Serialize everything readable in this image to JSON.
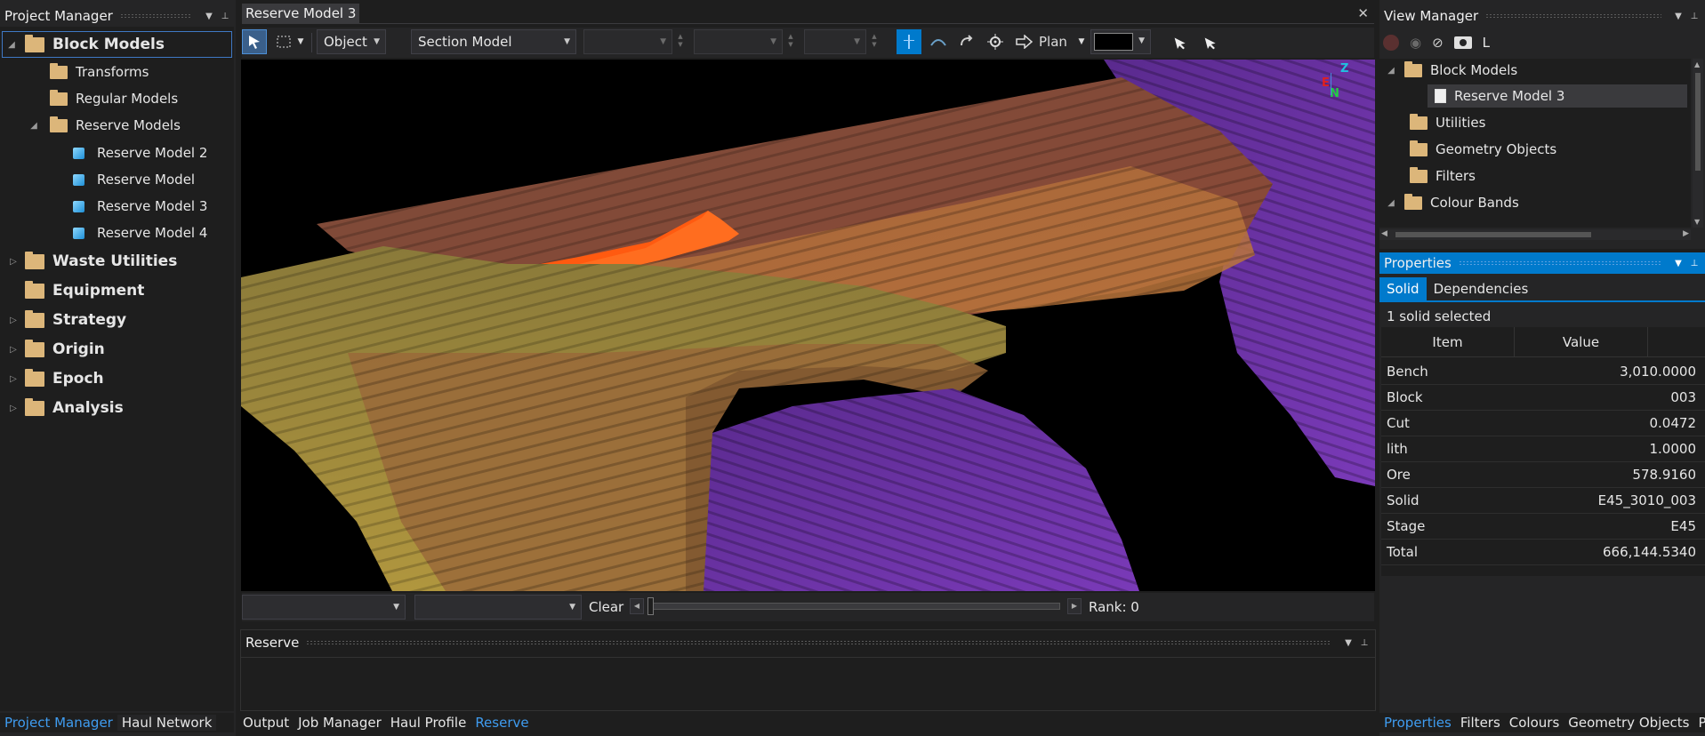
{
  "project_manager": {
    "title": "Project Manager",
    "tree": [
      {
        "label": "Block Models",
        "bold": true,
        "expander": "◢"
      },
      {
        "label": "Transforms"
      },
      {
        "label": "Regular Models"
      },
      {
        "label": "Reserve Models",
        "expander": "◢"
      },
      {
        "label": "Reserve Model 2"
      },
      {
        "label": "Reserve Model"
      },
      {
        "label": "Reserve Model 3"
      },
      {
        "label": "Reserve Model 4"
      },
      {
        "label": "Waste Utilities",
        "bold": true,
        "expander": "▷"
      },
      {
        "label": "Equipment",
        "bold": true
      },
      {
        "label": "Strategy",
        "bold": true,
        "expander": "▷"
      },
      {
        "label": "Origin",
        "bold": true,
        "expander": "▷"
      },
      {
        "label": "Epoch",
        "bold": true,
        "expander": "▷"
      },
      {
        "label": "Analysis",
        "bold": true,
        "expander": "▷"
      }
    ],
    "bottom_tabs": [
      "Project Manager",
      "Haul Network"
    ]
  },
  "document": {
    "tab_title": "Reserve Model 3",
    "close": "✕",
    "toolbar": {
      "select_mode": "Object",
      "section_mode": "Section Model",
      "plan_label": "Plan",
      "color_swatch": "#000000"
    },
    "axis": {
      "z": "Z",
      "e": "E",
      "n": "N"
    },
    "footer": {
      "clear_label": "Clear",
      "rank_label": "Rank: 0"
    }
  },
  "reserve_panel": {
    "title": "Reserve"
  },
  "center_bottom_tabs": [
    "Output",
    "Job Manager",
    "Haul Profile",
    "Reserve"
  ],
  "view_manager": {
    "title": "View Manager",
    "toolbar_letter": "L",
    "tree": [
      {
        "label": "Block Models",
        "expander": "◢"
      },
      {
        "label": "Reserve Model 3",
        "selected": true
      },
      {
        "label": "Utilities"
      },
      {
        "label": "Geometry Objects"
      },
      {
        "label": "Filters"
      },
      {
        "label": "Colour Bands",
        "expander": "◢"
      }
    ]
  },
  "properties": {
    "title": "Properties",
    "tabs": [
      "Solid",
      "Dependencies"
    ],
    "status": "1 solid selected",
    "columns": [
      "Item",
      "Value"
    ],
    "rows": [
      {
        "k": "Bench",
        "v": "3,010.0000"
      },
      {
        "k": "Block",
        "v": "003"
      },
      {
        "k": "Cut",
        "v": "0.0472"
      },
      {
        "k": "lith",
        "v": "1.0000"
      },
      {
        "k": "Ore",
        "v": "578.9160"
      },
      {
        "k": "Solid",
        "v": "E45_3010_003"
      },
      {
        "k": "Stage",
        "v": "E45"
      },
      {
        "k": "Total",
        "v": "666,144.5340"
      }
    ],
    "bottom_tabs": [
      "Properties",
      "Filters",
      "Colours",
      "Geometry Objects",
      "Pivot"
    ]
  },
  "colors": {
    "accent": "#007acc",
    "ore_highlight": "#ff5a10",
    "purple": "#7a3ab8",
    "gold": "#a89040"
  }
}
